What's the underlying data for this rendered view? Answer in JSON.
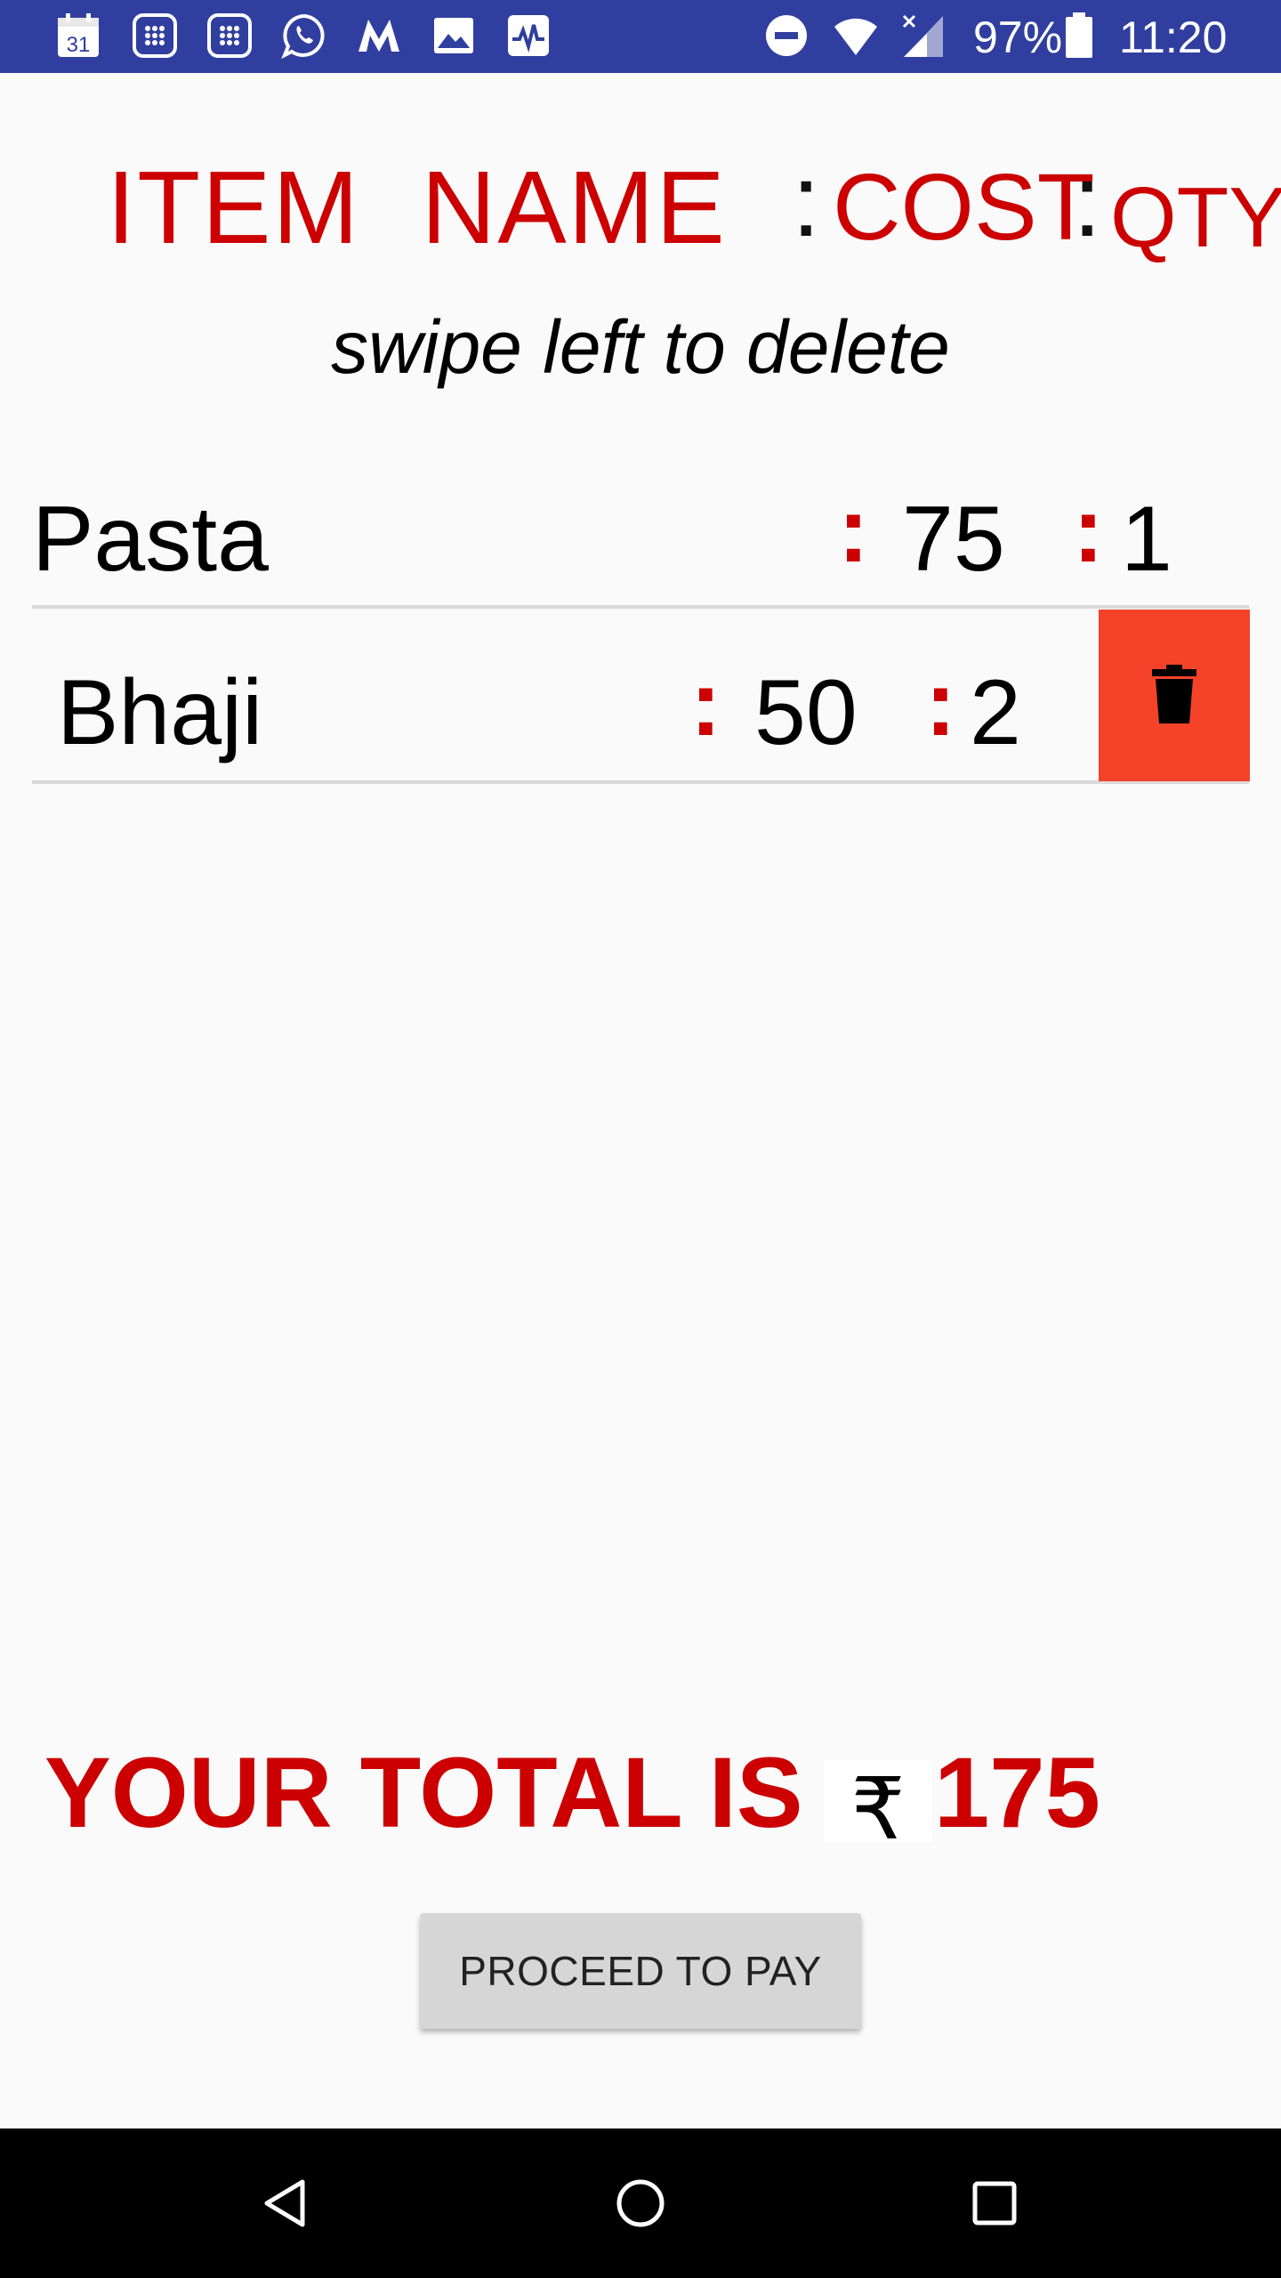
{
  "status_bar": {
    "calendar_date": "31",
    "battery_percent": "97%",
    "time": "11:20",
    "icons": [
      "calendar-icon",
      "app-grid-icon",
      "app-grid-icon",
      "whatsapp-icon",
      "myntra-icon",
      "gallery-icon",
      "activity-icon",
      "do-not-disturb-icon",
      "wifi-icon",
      "signal-icon",
      "battery-icon"
    ]
  },
  "header": {
    "item_name": "ITEM  NAME",
    "cost": "COST",
    "qty": "QTY",
    "colon": ":"
  },
  "hint": "swipe left to delete",
  "cart": {
    "separator": ":",
    "items": [
      {
        "name": "Pasta",
        "cost": "75",
        "qty": "1"
      },
      {
        "name": "Bhaji",
        "cost": "50",
        "qty": "2"
      }
    ]
  },
  "total": {
    "label": "YOUR TOTAL IS :",
    "currency": "₹",
    "value": "175"
  },
  "actions": {
    "pay_label": "PROCEED TO PAY"
  },
  "colors": {
    "status_bar": "#303f9f",
    "accent_red": "#cc0000",
    "delete_red": "#f44329",
    "button_grey": "#d6d6d6"
  }
}
